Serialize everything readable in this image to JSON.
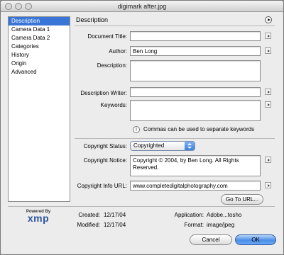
{
  "window": {
    "title": "digimark after.jpg"
  },
  "sidebar": {
    "items": [
      {
        "label": "Description",
        "selected": true
      },
      {
        "label": "Camera Data 1"
      },
      {
        "label": "Camera Data 2"
      },
      {
        "label": "Categories"
      },
      {
        "label": "History"
      },
      {
        "label": "Origin"
      },
      {
        "label": "Advanced"
      }
    ]
  },
  "panel": {
    "title": "Description",
    "document_title": {
      "label": "Document Title:",
      "value": ""
    },
    "author": {
      "label": "Author:",
      "value": "Ben Long"
    },
    "description": {
      "label": "Description:",
      "value": ""
    },
    "description_writer": {
      "label": "Description Writer:",
      "value": ""
    },
    "keywords": {
      "label": "Keywords:",
      "value": ""
    },
    "keywords_hint": "Commas can be used to separate keywords",
    "hint_icon_glyph": "!",
    "copyright_status": {
      "label": "Copyright Status:",
      "value": "Copyrighted"
    },
    "copyright_notice": {
      "label": "Copyright Notice:",
      "value": "Copyright © 2004, by Ben Long. All Rights Reserved."
    },
    "copyright_url": {
      "label": "Copyright Info URL:",
      "value": "www.completedigitalphotography.com"
    },
    "goto_url_label": "Go To URL..."
  },
  "footer": {
    "logo_top": "Powered By",
    "logo_main": "xmp",
    "created_label": "Created:",
    "created_value": "12/17/04",
    "modified_label": "Modified:",
    "modified_value": "12/17/04",
    "application_label": "Application:",
    "application_value": "Adobe...tosho",
    "format_label": "Format:",
    "format_value": "image/jpeg",
    "cancel_label": "Cancel",
    "ok_label": "OK"
  },
  "colors": {
    "selection": "#3875d7",
    "primary_button": "#4b8fe6",
    "xmp_logo": "#2b54a0"
  }
}
